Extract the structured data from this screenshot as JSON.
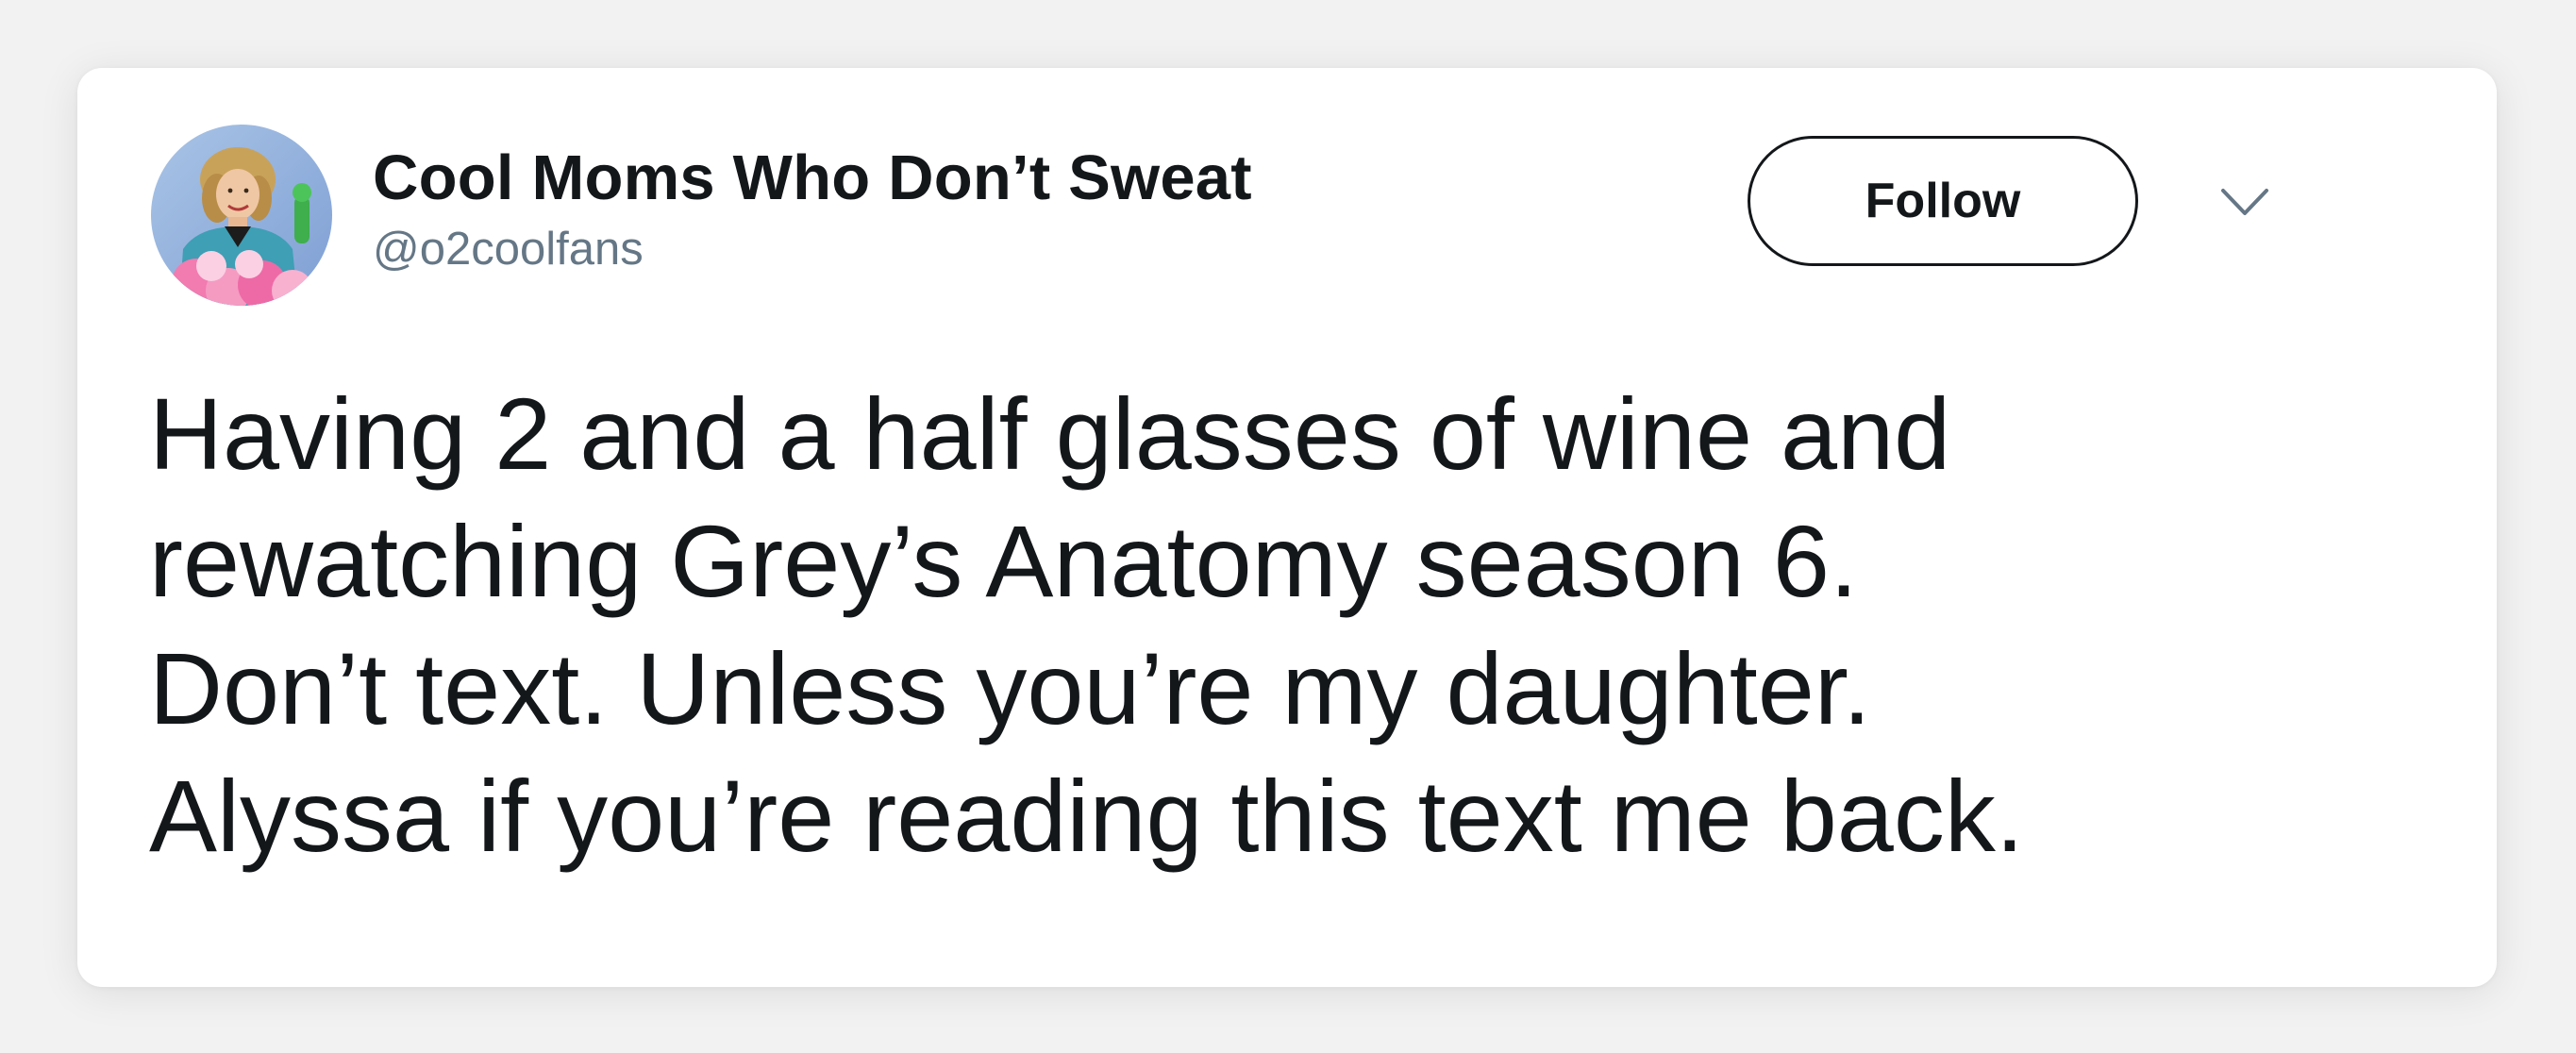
{
  "tweet": {
    "author": {
      "display_name": "Cool Moms Who Don’t Sweat",
      "handle": "@o2coolfans",
      "avatar_icon": "profile-photo"
    },
    "follow_label": "Follow",
    "menu_icon": "chevron-down-icon",
    "text_lines": [
      "Having 2 and a half glasses of wine and",
      "rewatching Grey’s Anatomy season 6.",
      "Don’t text. Unless you’re my daughter.",
      "Alyssa if you’re reading this text me back."
    ]
  },
  "colors": {
    "text_primary": "#14171a",
    "text_secondary": "#657786",
    "card_background": "#ffffff",
    "page_background": "#f2f2f2"
  }
}
